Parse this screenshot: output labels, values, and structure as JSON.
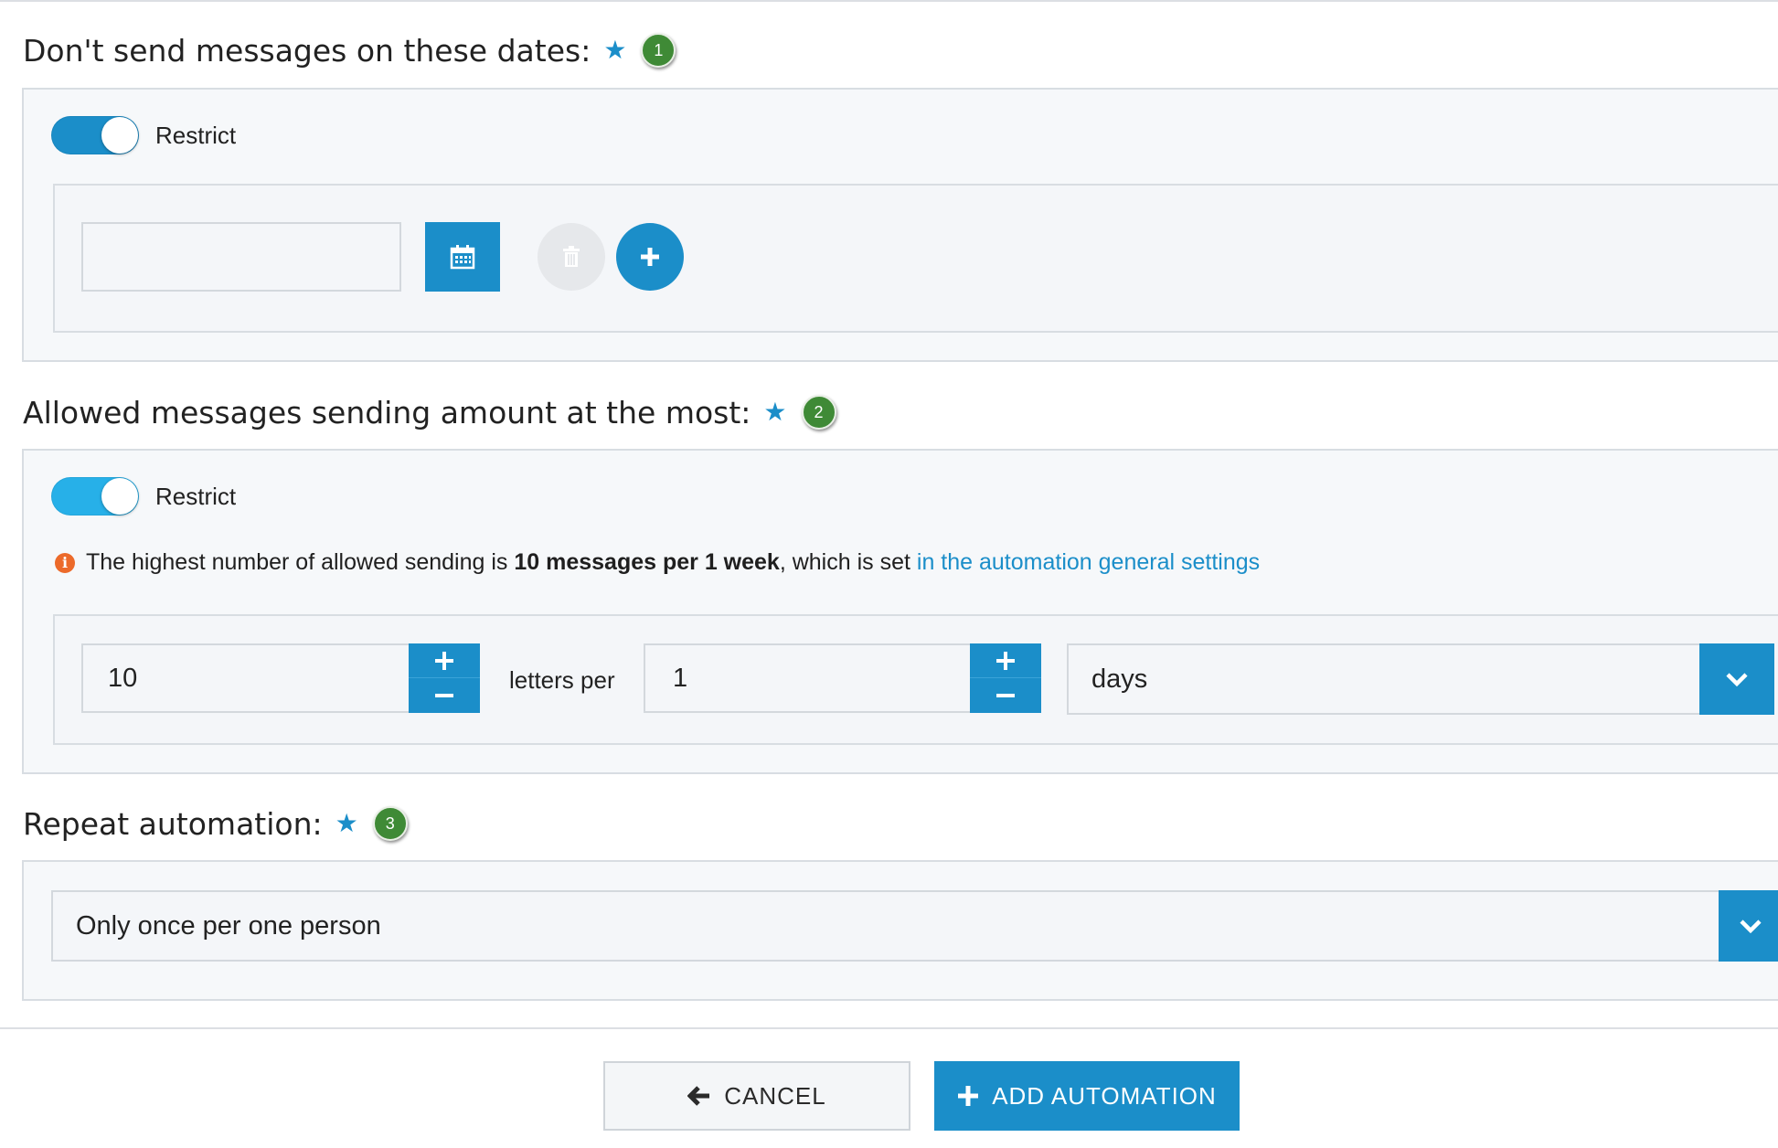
{
  "section1": {
    "title": "Don't send messages on these dates:",
    "star": "★",
    "badge": "1",
    "toggle_label": "Restrict",
    "toggle_on": true,
    "date_input_value": "",
    "icons": {
      "calendar": "calendar-icon",
      "delete": "trash-icon",
      "add": "plus-icon"
    }
  },
  "section2": {
    "title": "Allowed messages sending amount at the most:",
    "star": "★",
    "badge": "2",
    "toggle_label": "Restrict",
    "toggle_on": true,
    "info": {
      "icon": "i",
      "text_before": "The highest number of allowed sending is ",
      "bold": "10 messages per 1 week",
      "text_after": ", which is set ",
      "link": "in the automation general settings"
    },
    "letters_value": "10",
    "letters_per_label": "letters per",
    "period_value": "1",
    "period_unit": "days"
  },
  "section3": {
    "title": "Repeat automation:",
    "star": "★",
    "badge": "3",
    "repeat_value": "Only once per one person"
  },
  "footer": {
    "cancel_label": "CANCEL",
    "add_label": "ADD AUTOMATION"
  },
  "colors": {
    "accent": "#1b8ec9",
    "badge": "#3f8a36",
    "info": "#ec6a2a",
    "panel_bg": "#f6f8fa",
    "border": "#d8dde2"
  }
}
